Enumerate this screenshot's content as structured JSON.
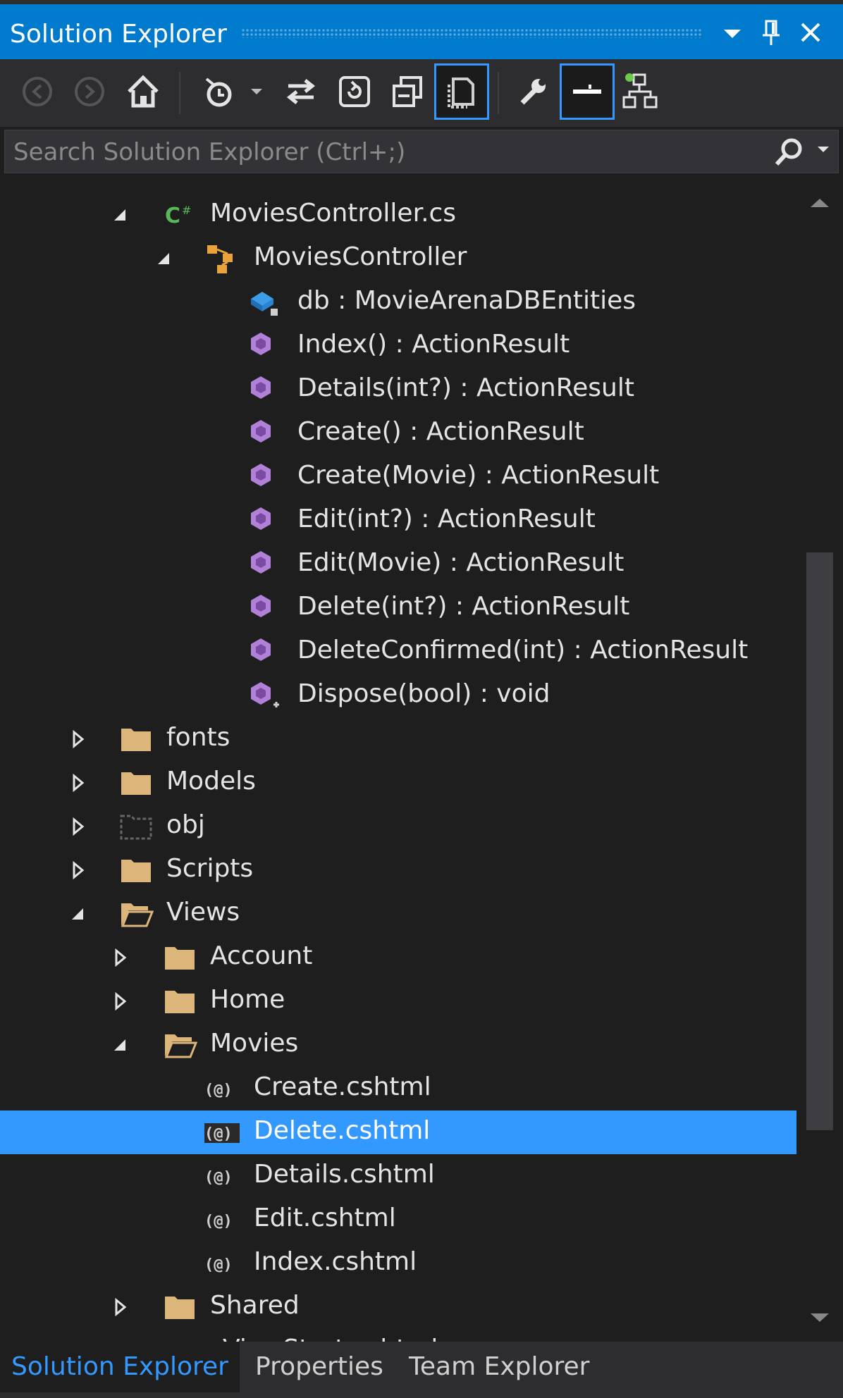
{
  "window": {
    "title": "Solution Explorer"
  },
  "search": {
    "placeholder": "Search Solution Explorer (Ctrl+;)"
  },
  "tree": {
    "rows": [
      {
        "label": "MoviesController.cs"
      },
      {
        "label": "MoviesController"
      },
      {
        "label": "db : MovieArenaDBEntities"
      },
      {
        "label": "Index() : ActionResult"
      },
      {
        "label": "Details(int?) : ActionResult"
      },
      {
        "label": "Create() : ActionResult"
      },
      {
        "label": "Create(Movie) : ActionResult"
      },
      {
        "label": "Edit(int?) : ActionResult"
      },
      {
        "label": "Edit(Movie) : ActionResult"
      },
      {
        "label": "Delete(int?) : ActionResult"
      },
      {
        "label": "DeleteConfirmed(int) : ActionResult"
      },
      {
        "label": "Dispose(bool) : void"
      },
      {
        "label": "fonts"
      },
      {
        "label": "Models"
      },
      {
        "label": "obj"
      },
      {
        "label": "Scripts"
      },
      {
        "label": "Views"
      },
      {
        "label": "Account"
      },
      {
        "label": "Home"
      },
      {
        "label": "Movies"
      },
      {
        "label": "Create.cshtml"
      },
      {
        "label": "Delete.cshtml"
      },
      {
        "label": "Details.cshtml"
      },
      {
        "label": "Edit.cshtml"
      },
      {
        "label": "Index.cshtml"
      },
      {
        "label": "Shared"
      },
      {
        "label": "_ViewStart.cshtml"
      }
    ]
  },
  "tabs": [
    {
      "label": "Solution Explorer"
    },
    {
      "label": "Properties"
    },
    {
      "label": "Team Explorer"
    }
  ],
  "colors": {
    "accent": "#007acc",
    "selection": "#3399ff",
    "folder": "#dcb67a",
    "method": "#b180d7",
    "class_icon": "#e8a33d",
    "field": "#3c9ce7",
    "file_cs": "#5bb55b"
  }
}
